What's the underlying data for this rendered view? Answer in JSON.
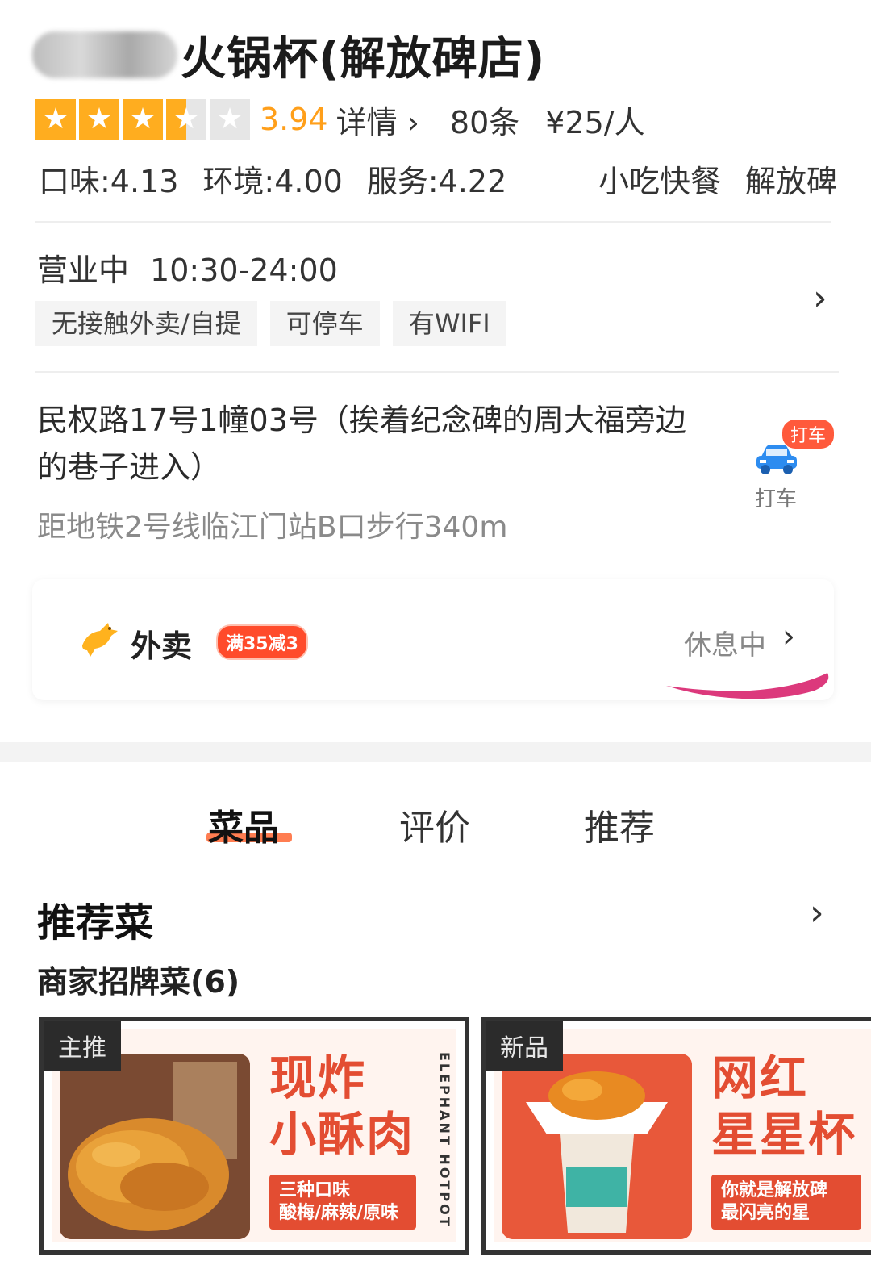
{
  "header": {
    "title": "火锅杯(解放碑店)",
    "rating": 3.5,
    "score": "3.94",
    "detail_label": "详情",
    "review_count": "80条",
    "price": "¥25/人"
  },
  "scores": {
    "taste": "口味:4.13",
    "environment": "环境:4.00",
    "service": "服务:4.22",
    "category": "小吃快餐",
    "area": "解放碑"
  },
  "hours": {
    "status": "营业中",
    "time": "10:30-24:00",
    "tags": [
      "无接触外卖/自提",
      "可停车",
      "有WIFI"
    ]
  },
  "address": {
    "text": "民权路17号1幢03号（挨着纪念碑的周大福旁边的巷子进入）",
    "metro": "距地铁2号线临江门站B口步行340m",
    "taxi_badge": "打车",
    "taxi_label": "打车"
  },
  "delivery": {
    "label": "外卖",
    "promo": "满35减3",
    "status": "休息中"
  },
  "tabs": [
    "菜品",
    "评价",
    "推荐"
  ],
  "recommend": {
    "title": "推荐菜",
    "subtitle": "商家招牌菜(6)",
    "cards": [
      {
        "tag": "主推",
        "headline1": "现炸",
        "headline2": "小酥肉",
        "ribbon1": "三种口味",
        "ribbon2": "酸梅/麻辣/原味",
        "vertical": "ELEPHANT HOTPOT"
      },
      {
        "tag": "新品",
        "headline1": "网红",
        "headline2": "星星杯",
        "ribbon1": "你就是解放碑",
        "ribbon2": "最闪亮的星"
      }
    ]
  },
  "colors": {
    "star": "#ffad1f",
    "score": "#ff9f1a",
    "accent": "#e34d32",
    "scribble": "#d8246e"
  }
}
